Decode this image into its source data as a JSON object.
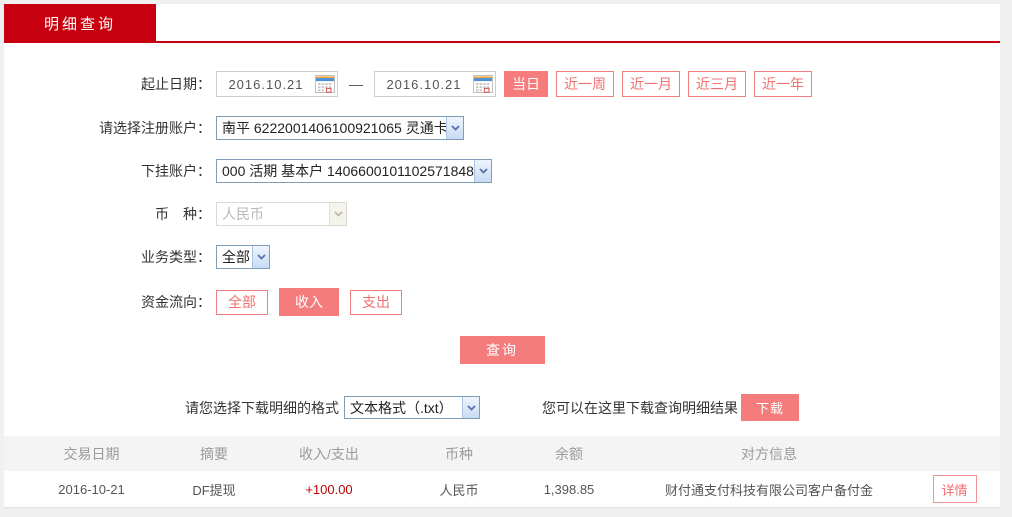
{
  "tab": {
    "label": "明细查询"
  },
  "colors": {
    "brand_red": "#c6000e",
    "accent_salmon": "#f47c7c",
    "accent_salmon_border": "#f08080",
    "amount_income_red": "#c00000"
  },
  "form": {
    "date_range": {
      "label": "起止日期：",
      "start_value": "2016.10.21",
      "end_value": "2016.10.21",
      "separator": "—",
      "quick_buttons": [
        {
          "label": "当日",
          "active": true
        },
        {
          "label": "近一周",
          "active": false
        },
        {
          "label": "近一月",
          "active": false
        },
        {
          "label": "近三月",
          "active": false
        },
        {
          "label": "近一年",
          "active": false
        }
      ]
    },
    "registered_account": {
      "label": "请选择注册账户：",
      "value": "南平 6222001406100921065 灵通卡"
    },
    "sub_account": {
      "label": "下挂账户：",
      "value": "000 活期 基本户 1406600101102571848"
    },
    "currency": {
      "label": "币　种：",
      "value": "人民币",
      "disabled": true
    },
    "business_type": {
      "label": "业务类型：",
      "value": "全部"
    },
    "fund_flow": {
      "label": "资金流向：",
      "options": [
        {
          "label": "全部",
          "active": false
        },
        {
          "label": "收入",
          "active": true
        },
        {
          "label": "支出",
          "active": false
        }
      ]
    },
    "query_button_label": "查询"
  },
  "download": {
    "format_label": "请您选择下载明细的格式",
    "format_value": "文本格式（.txt）",
    "hint": "您可以在这里下载查询明细结果",
    "button_label": "下载"
  },
  "table": {
    "headers": [
      "交易日期",
      "摘要",
      "收入/支出",
      "币种",
      "余额",
      "对方信息"
    ],
    "rows": [
      {
        "date": "2016-10-21",
        "summary": "DF提现",
        "amount": "+100.00",
        "currency": "人民币",
        "balance": "1,398.85",
        "counterparty": "财付通支付科技有限公司客户备付金",
        "detail_label": "详情"
      }
    ]
  }
}
